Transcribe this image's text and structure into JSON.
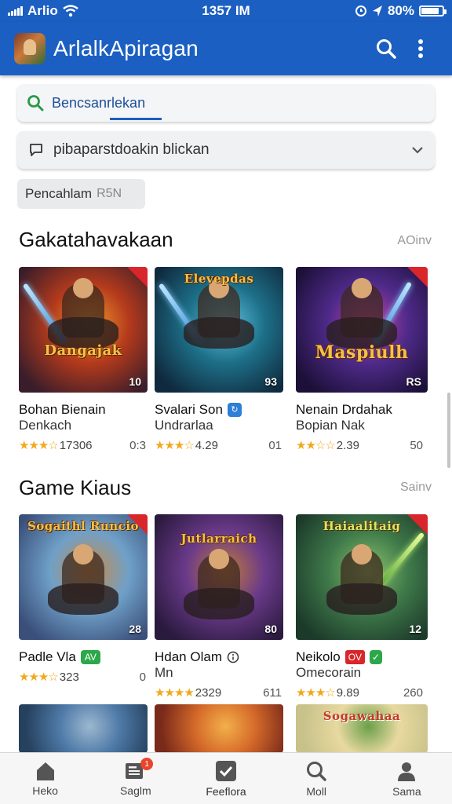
{
  "status_bar": {
    "carrier": "Arlio",
    "time": "1357 IM",
    "battery": "80%"
  },
  "app_bar": {
    "title": "ArlalkApiragan"
  },
  "search": {
    "label": "Bencsanrlekan"
  },
  "filter": {
    "label": "pibaparstdoakin blickan"
  },
  "chip": {
    "label": "Pencahlam",
    "count": "R5N"
  },
  "sections": [
    {
      "title": "Gakatahavakaan",
      "more": "AOinv",
      "cards": [
        {
          "art_title": "Dangajak",
          "count": "10",
          "name1": "Bohan Bienain",
          "name2": "Denkach",
          "rating": "17306",
          "extra": "0:3",
          "stars": "★★★☆",
          "colors": [
            "#3a1d2a",
            "#b43a1c",
            "#f09a2a"
          ]
        },
        {
          "art_title": "Elevepdas",
          "count": "93",
          "name1": "Svalari Son",
          "name2": "Undrarlaa",
          "rating": "4.29",
          "extra": "01",
          "stars": "★★★☆",
          "colors": [
            "#0f2a3e",
            "#1d6f88",
            "#5fc2e0"
          ]
        },
        {
          "art_title": "Maspiulh",
          "count": "RS",
          "name1": "Nenain Drdahak",
          "name2": "Bopian Nak",
          "rating": "2.39",
          "extra": "50",
          "stars": "★★☆☆",
          "colors": [
            "#1c1038",
            "#4f2a8a",
            "#c544a8"
          ]
        }
      ]
    },
    {
      "title": "Game Kiaus",
      "more": "Sainv",
      "cards": [
        {
          "art_title": "Sogaithl Runcio",
          "count": "28",
          "name1": "Padle Vla",
          "name2": "",
          "badge": "AV",
          "rating": "323",
          "extra": "0",
          "stars": "★★★☆",
          "colors": [
            "#3a4f7a",
            "#6fa0c8",
            "#c98a46"
          ]
        },
        {
          "art_title": "Jutlarraich",
          "count": "80",
          "name1": "Hdan Olam",
          "name2": "Mn",
          "rating": "2329",
          "extra": "611",
          "stars": "★★★★",
          "colors": [
            "#2a1a3e",
            "#6a3a8a",
            "#c07a3a"
          ]
        },
        {
          "art_title": "Haiaalitaig",
          "count": "12",
          "name1": "Neikolo",
          "name2": "Omecorain",
          "badge": "OV",
          "rating": "9.89",
          "extra": "260",
          "stars": "★★★☆",
          "colors": [
            "#1c3a2a",
            "#3f7a4a",
            "#8ac06a"
          ]
        }
      ]
    }
  ],
  "peek_row": [
    {
      "art_title": "",
      "colors": [
        "#26415e",
        "#4f7aa8",
        "#9cb8d0"
      ]
    },
    {
      "art_title": "",
      "colors": [
        "#7a2a1a",
        "#d56a2a",
        "#f3b04a"
      ]
    },
    {
      "art_title": "Sogawahaa",
      "colors": [
        "#c8c28a",
        "#e8d9a0",
        "#6aa04a"
      ]
    }
  ],
  "bottom_nav": [
    {
      "label": "Heko",
      "icon": "home-icon"
    },
    {
      "label": "Saglm",
      "icon": "news-icon",
      "badge": "1"
    },
    {
      "label": "Feeflora",
      "icon": "check-icon"
    },
    {
      "label": "Moll",
      "icon": "search-icon"
    },
    {
      "label": "Sama",
      "icon": "user-icon"
    }
  ]
}
